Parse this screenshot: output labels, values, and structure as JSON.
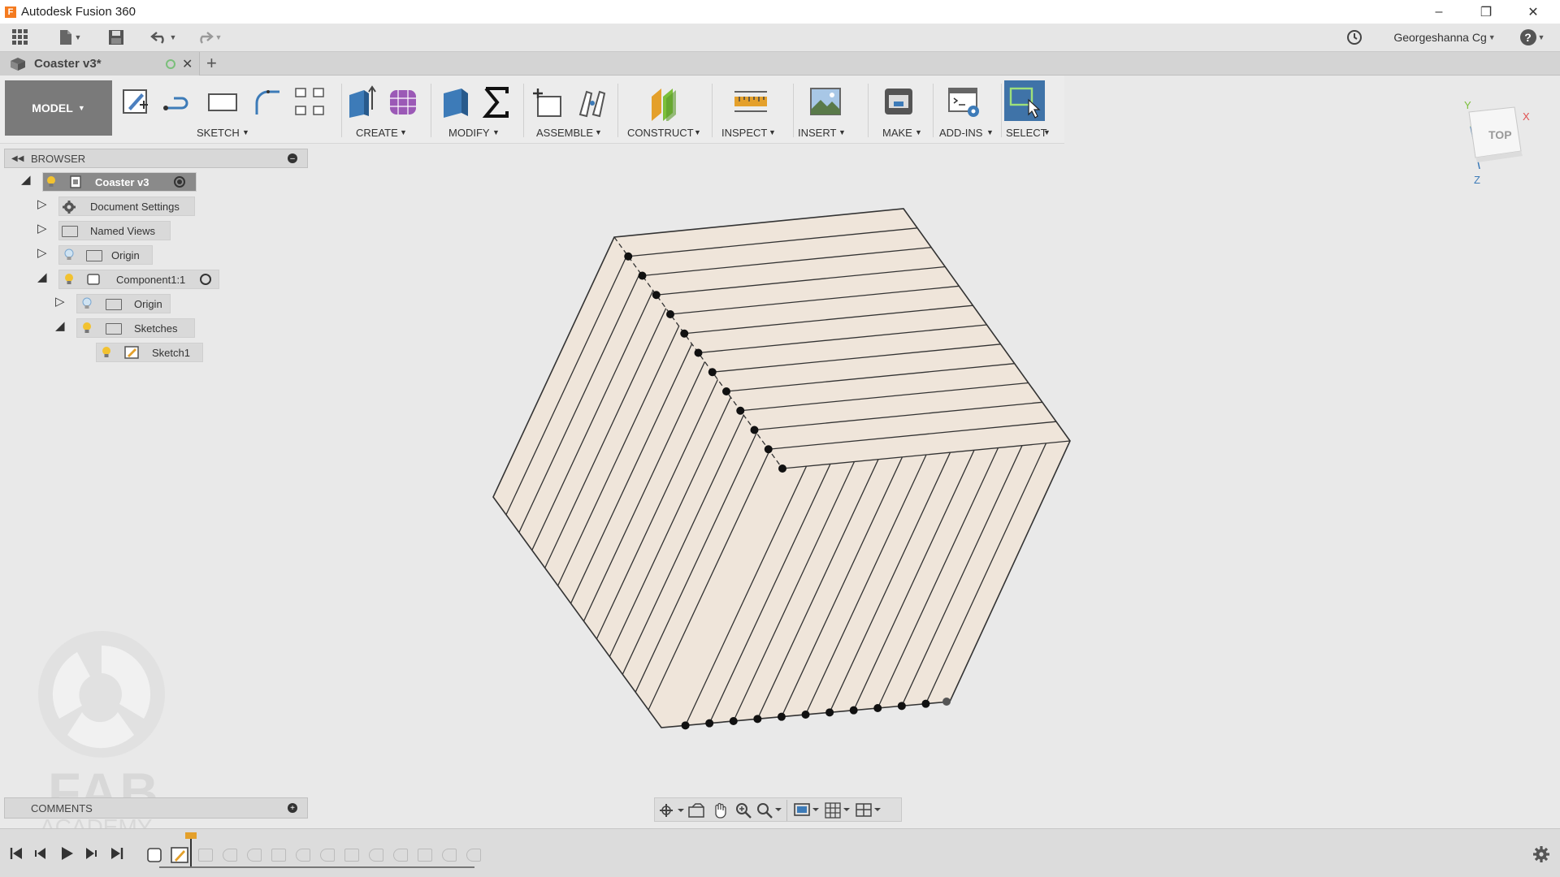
{
  "window": {
    "title": "Autodesk Fusion 360",
    "app_icon": "F"
  },
  "qat": {
    "user": "Georgeshanna Cg",
    "help": "?"
  },
  "tab": {
    "name": "Coaster v3*",
    "new_tab": "+"
  },
  "toolbar": {
    "workspace": "MODEL",
    "groups": [
      "SKETCH",
      "CREATE",
      "MODIFY",
      "ASSEMBLE",
      "CONSTRUCT",
      "INSPECT",
      "INSERT",
      "MAKE",
      "ADD-INS",
      "SELECT"
    ]
  },
  "browser": {
    "title": "BROWSER",
    "nodes": [
      {
        "label": "Coaster v3"
      },
      {
        "label": "Document Settings"
      },
      {
        "label": "Named Views"
      },
      {
        "label": "Origin"
      },
      {
        "label": "Component1:1"
      },
      {
        "label": "Origin"
      },
      {
        "label": "Sketches"
      },
      {
        "label": "Sketch1"
      }
    ]
  },
  "viewcube": {
    "face": "TOP",
    "axis_x": "X",
    "axis_y": "Y",
    "axis_z": "Z"
  },
  "comments": {
    "title": "COMMENTS"
  },
  "watermark": {
    "line1": "FAB",
    "line2": "ACADEMY"
  },
  "colors": {
    "accent_blue": "#3d7bb8",
    "model_fill": "#efe5da",
    "select_active": "#3f73a8"
  }
}
